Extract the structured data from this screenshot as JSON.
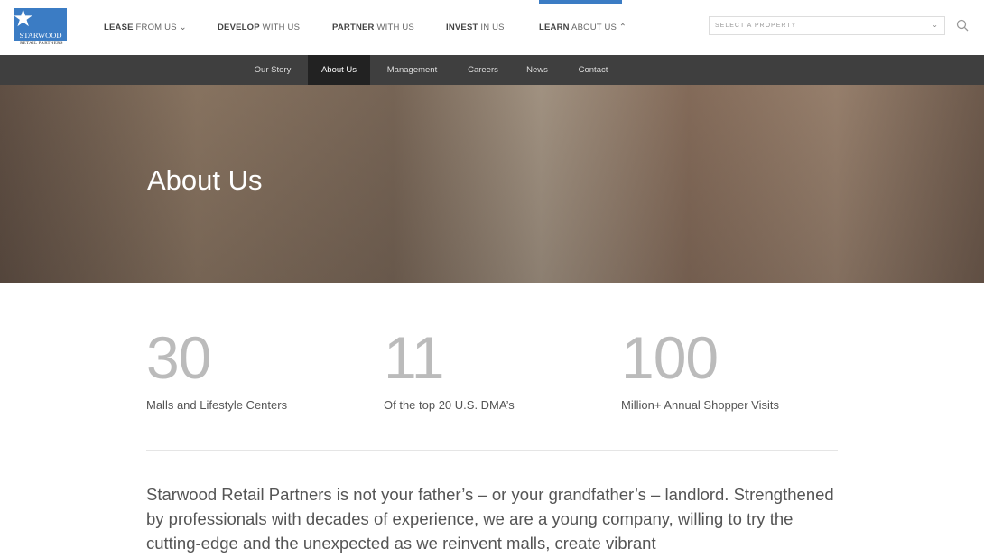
{
  "brand": {
    "name": "STARWOOD",
    "tagline": "RETAIL PARTNERS",
    "color": "#3b7cc4"
  },
  "main_nav": [
    {
      "bold": "LEASE",
      "rest": " FROM US",
      "chevron": "⌄"
    },
    {
      "bold": "DEVELOP",
      "rest": " WITH US"
    },
    {
      "bold": "PARTNER",
      "rest": " WITH US"
    },
    {
      "bold": "INVEST",
      "rest": " IN US"
    },
    {
      "bold": "LEARN",
      "rest": " ABOUT US",
      "chevron": "⌃",
      "active": true
    }
  ],
  "property_select": {
    "placeholder": "SELECT A PROPERTY",
    "icon": "chevron-down-icon"
  },
  "search": {
    "icon": "search-icon"
  },
  "sub_nav": [
    "Our Story",
    "About Us",
    "Management",
    "Careers",
    "News",
    "Contact"
  ],
  "sub_nav_active": "About Us",
  "sub_nav_color": "#3f3f3f",
  "hero": {
    "title": "About Us"
  },
  "stats": [
    {
      "value": "30",
      "label": "Malls and Lifestyle Centers"
    },
    {
      "value": "11",
      "label": "Of the top 20 U.S. DMA’s"
    },
    {
      "value": "100",
      "label": "Million+ Annual Shopper Visits"
    }
  ],
  "intro": "Starwood Retail Partners is not your father’s – or your grandfather’s – landlord. Strengthened by professionals with decades of experience, we are a young company, willing to try the cutting-edge and the unexpected as we reinvent malls, create vibrant"
}
